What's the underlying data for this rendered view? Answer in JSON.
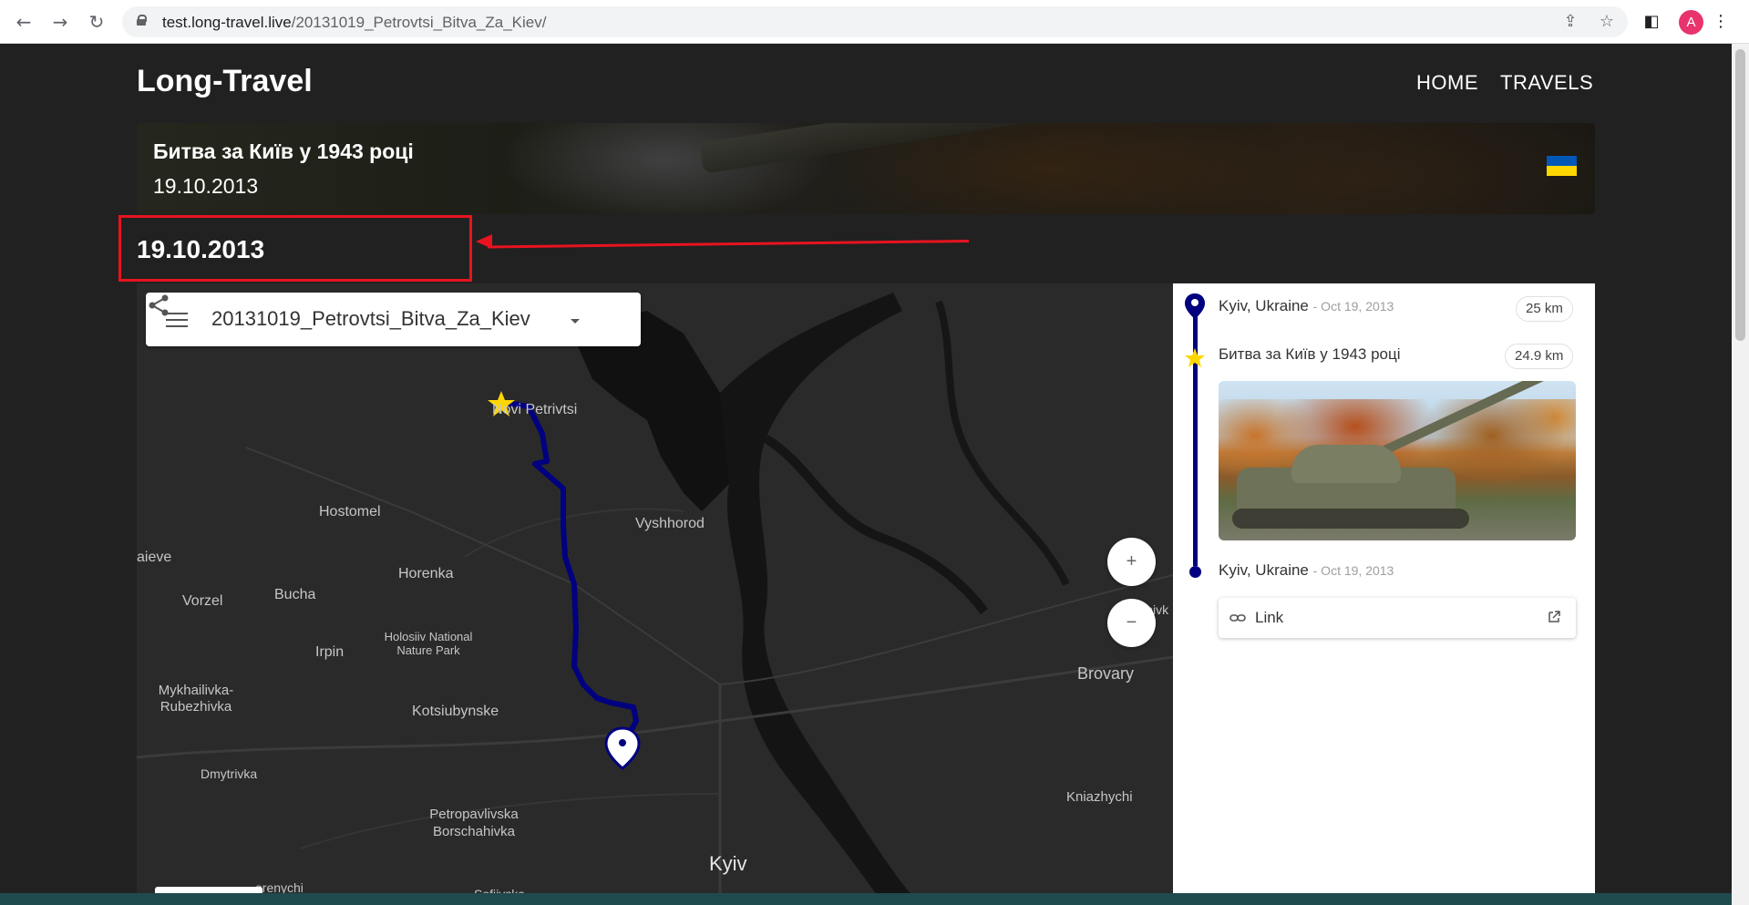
{
  "browser": {
    "url_host": "test.long-travel.live",
    "url_path": "/20131019_Petrovtsi_Bitva_Za_Kiev/",
    "profile_initial": "A"
  },
  "site": {
    "brand": "Long-Travel",
    "nav": [
      "HOME",
      "TRAVELS"
    ]
  },
  "hero": {
    "title": "Битва за Київ у 1943 році",
    "date": "19.10.2013"
  },
  "day_heading": "19.10.2013",
  "map": {
    "title": "20131019_Petrovtsi_Bitva_Za_Kiev",
    "zoom_in": "+",
    "zoom_out": "−",
    "labels": {
      "novi_petrivtsi": "Novi Petrivtsi",
      "hostomel": "Hostomel",
      "vyshhorod": "Vyshhorod",
      "gaieve": "aieve",
      "horenka": "Horenka",
      "vorzel": "Vorzel",
      "bucha": "Bucha",
      "holosiiv": "Holosiiv National Nature Park",
      "irpin": "Irpin",
      "mykhailivka": "Mykhailivka-Rubezhivka",
      "kotsiubynske": "Kotsiubynske",
      "dmytrivka": "Dmytrivka",
      "petropavlivska": "Petropavlivska Borschahivka",
      "kyiv": "Kyiv",
      "kalynivka": "Kalynivk",
      "brovary": "Brovary",
      "kniazhychi": "Kniazhychi",
      "horenychi": "orenychi",
      "sofiivska": "Sofiivska"
    }
  },
  "timeline": {
    "items": [
      {
        "place": "Kyiv, Ukraine",
        "when": "- Oct 19, 2013",
        "distance": "25 km"
      },
      {
        "place": "Битва за Київ у 1943 році",
        "distance": "24.9 km"
      },
      {
        "place": "Kyiv, Ukraine",
        "when": "- Oct 19, 2013"
      }
    ],
    "link_label": "Link"
  },
  "colors": {
    "route": "#000080",
    "annotation": "#e8131f",
    "star": "#ffd700"
  }
}
